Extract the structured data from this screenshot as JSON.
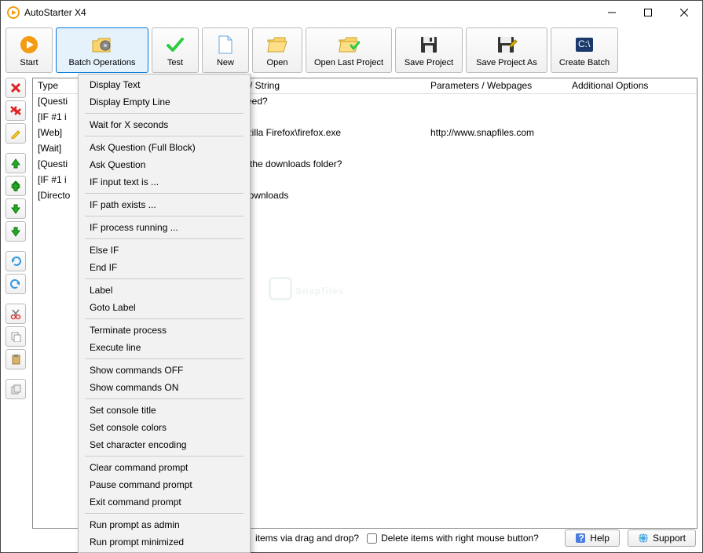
{
  "window": {
    "title": "AutoStarter X4"
  },
  "toolbar": {
    "start": "Start",
    "batch_operations": "Batch Operations",
    "test": "Test",
    "new": "New",
    "open": "Open",
    "open_last": "Open Last Project",
    "save_project": "Save Project",
    "save_project_as": "Save Project As",
    "create_batch": "Create Batch"
  },
  "columns": {
    "c1": "Type",
    "c2": "n / String",
    "c3": "Parameters / Webpages",
    "c4": "Additional Options"
  },
  "rows": [
    {
      "c1": "[Questi",
      "c2": "ceed?",
      "c3": "",
      "c4": ""
    },
    {
      "c1": "[IF #1 i",
      "c2": "",
      "c3": "",
      "c4": ""
    },
    {
      "c1": "[Web]",
      "c2": "ozilla Firefox\\firefox.exe",
      "c3": "http://www.snapfiles.com",
      "c4": ""
    },
    {
      "c1": "[Wait]",
      "c2": "",
      "c3": "",
      "c4": ""
    },
    {
      "c1": "[Questi",
      "c2": "n the downloads folder?",
      "c3": "",
      "c4": ""
    },
    {
      "c1": "[IF #1 i",
      "c2": "",
      "c3": "",
      "c4": ""
    },
    {
      "c1": "[Directo",
      "c2": "Downloads",
      "c3": "",
      "c4": ""
    }
  ],
  "dropdown": [
    "Display Text",
    "Display Empty Line",
    "---",
    "Wait for X seconds",
    "---",
    "Ask Question (Full Block)",
    "Ask Question",
    "IF input text is ...",
    "---",
    "IF path exists ...",
    "---",
    "IF process running ...",
    "---",
    "Else IF",
    "End IF",
    "---",
    "Label",
    "Goto Label",
    "---",
    "Terminate process",
    "Execute line",
    "---",
    "Show commands OFF",
    "Show commands ON",
    "---",
    "Set console title",
    "Set console colors",
    "Set character encoding",
    "---",
    "Clear command prompt",
    "Pause command prompt",
    "Exit command prompt",
    "---",
    "Run prompt as admin",
    "Run prompt minimized"
  ],
  "footer": {
    "move_drag": "items via drag and drop?",
    "delete_right": "Delete items with right mouse button?",
    "help": "Help",
    "support": "Support"
  },
  "watermark": "Snapfiles"
}
